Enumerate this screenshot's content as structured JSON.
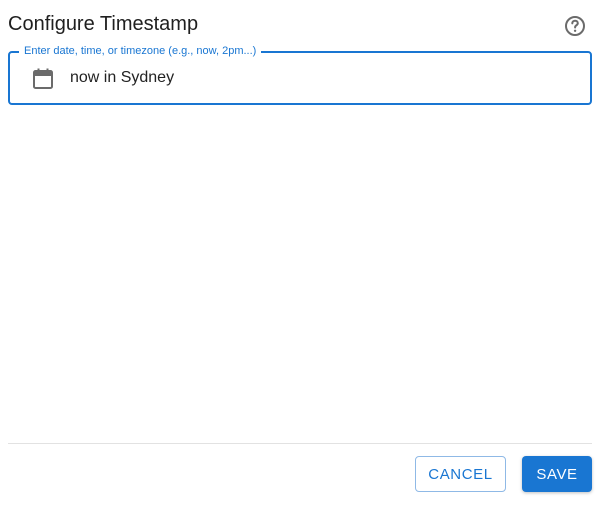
{
  "dialog": {
    "title": "Configure Timestamp",
    "help_icon": "help-circle-icon",
    "field": {
      "label": "Enter date, time, or timezone (e.g., now, 2pm...)",
      "value": "now in Sydney",
      "icon": "calendar-icon"
    },
    "actions": {
      "cancel_label": "CANCEL",
      "save_label": "SAVE"
    }
  },
  "colors": {
    "accent": "#1976d2",
    "divider": "#e2e2e2",
    "icon": "#6b6b6b"
  }
}
